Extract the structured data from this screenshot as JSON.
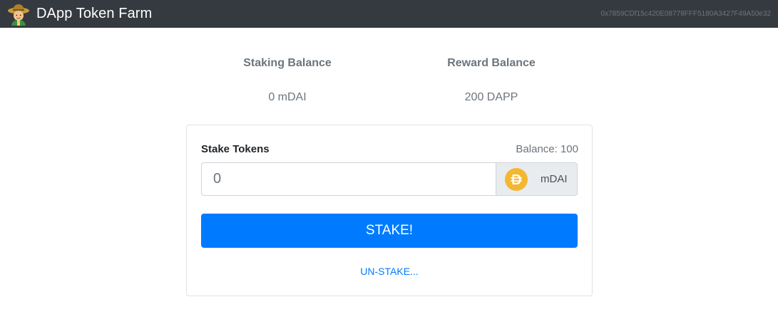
{
  "navbar": {
    "icon": "farmer-emoji-icon",
    "title": "DApp Token Farm",
    "account": "0x7859CDf15c420E08778FFF5180A3427F49A50e32"
  },
  "balances": {
    "staking": {
      "label": "Staking Balance",
      "value": "0 mDAI"
    },
    "reward": {
      "label": "Reward Balance",
      "value": "200 DAPP"
    }
  },
  "stake_form": {
    "title": "Stake Tokens",
    "balance_text": "Balance: 100",
    "input_placeholder": "0",
    "input_value": "",
    "token_icon": "dai-icon",
    "token_unit": "mDAI",
    "stake_label": "STAKE!",
    "unstake_label": "UN-STAKE..."
  },
  "colors": {
    "navbar_bg": "#343a40",
    "primary": "#007bff",
    "muted": "#6c757d",
    "dai": "#f4b731"
  }
}
